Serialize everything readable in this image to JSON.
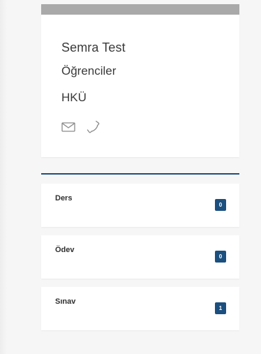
{
  "profile": {
    "name": "Semra Test",
    "role": "Öğrenciler",
    "organization": "HKÜ",
    "icons": [
      "envelope-icon",
      "phone-icon"
    ]
  },
  "stats": [
    {
      "label": "Ders",
      "count": "0"
    },
    {
      "label": "Ödev",
      "count": "0"
    },
    {
      "label": "Sınav",
      "count": "1"
    }
  ],
  "colors": {
    "accent": "#1b4f7f",
    "topbar": "#a9a9a9",
    "icon": "#8a8a8a"
  }
}
